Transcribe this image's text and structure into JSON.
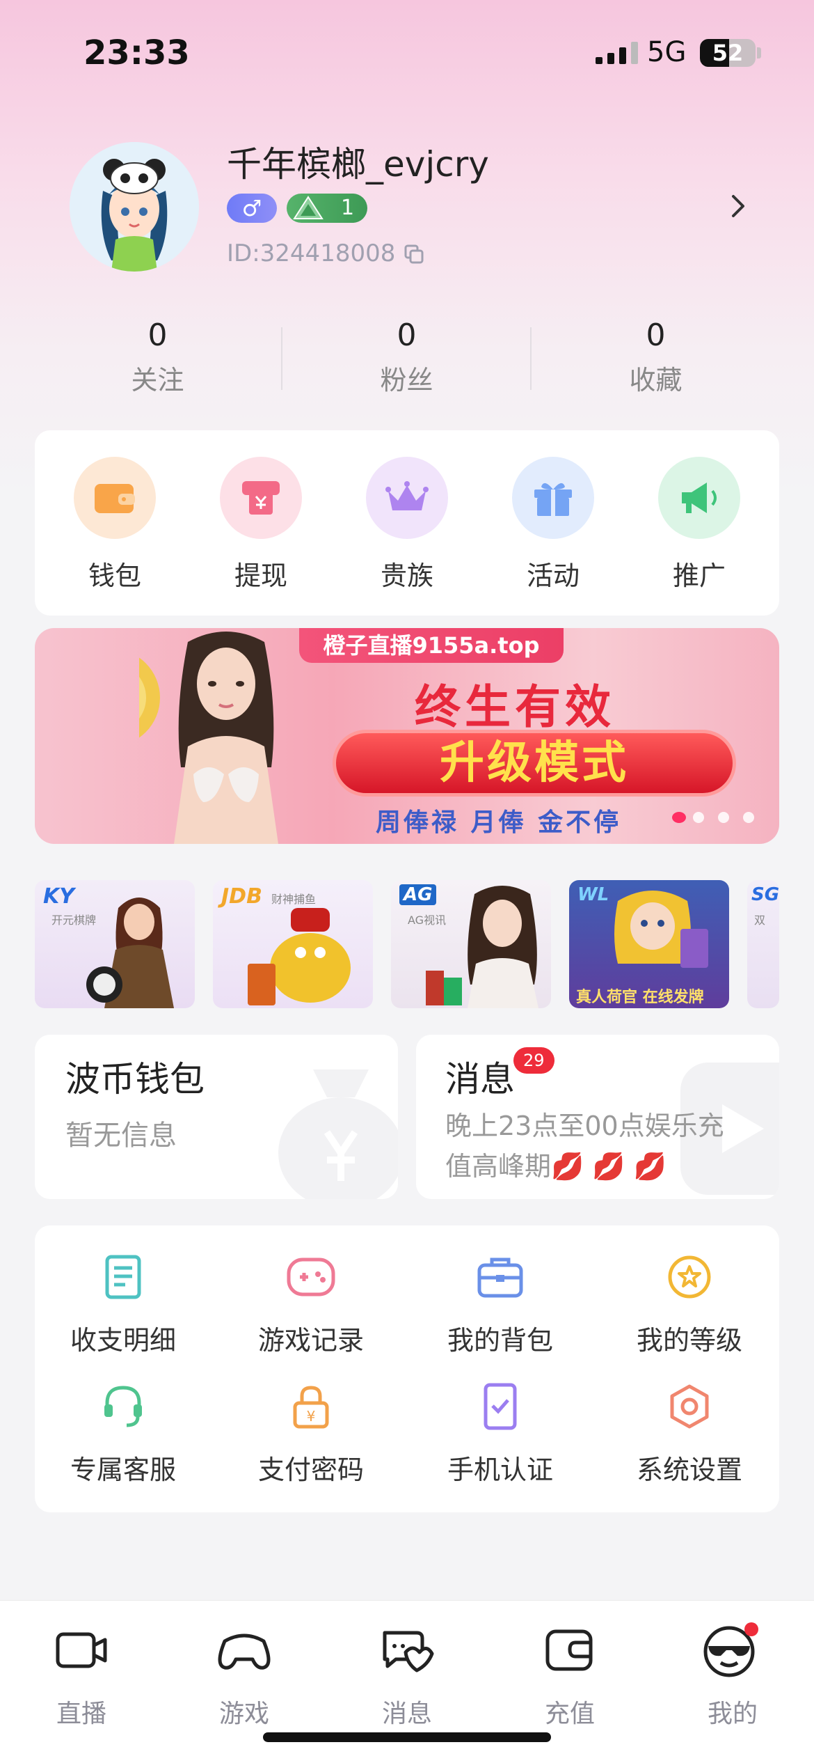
{
  "status": {
    "time": "23:33",
    "network": "5G",
    "battery": "52"
  },
  "profile": {
    "username": "千年槟榔_evjcry",
    "gender_symbol": "♂",
    "level": "1",
    "id": "ID:324418008"
  },
  "stats": [
    {
      "value": "0",
      "label": "关注"
    },
    {
      "value": "0",
      "label": "粉丝"
    },
    {
      "value": "0",
      "label": "收藏"
    }
  ],
  "quick": [
    {
      "label": "钱包",
      "color": "#f8a048"
    },
    {
      "label": "提现",
      "color": "#f2607e"
    },
    {
      "label": "贵族",
      "color": "#a77cf0"
    },
    {
      "label": "活动",
      "color": "#6f9ef5"
    },
    {
      "label": "推广",
      "color": "#3ec47a"
    }
  ],
  "banner": {
    "top": "橙子直播9155a.top",
    "main": "终生有效",
    "pill": "升级模式",
    "sub": "周俸禄  月俸  金不停"
  },
  "games": [
    {
      "logo": "KY",
      "sub": "开元棋牌"
    },
    {
      "logo": "JDB",
      "sub": "财神捕鱼"
    },
    {
      "logo": "AG",
      "sub": "AG视讯"
    },
    {
      "logo": "WL",
      "sub": "真人荷官 在线发牌"
    },
    {
      "logo": "SG",
      "sub": "双"
    }
  ],
  "wallet": {
    "title": "波币钱包",
    "text": "暂无信息"
  },
  "message": {
    "title": "消息",
    "badge": "29",
    "text1": "晚上23点至00点娱乐充",
    "text2": "值高峰期💋 💋 💋"
  },
  "menu": [
    {
      "label": "收支明细"
    },
    {
      "label": "游戏记录"
    },
    {
      "label": "我的背包"
    },
    {
      "label": "我的等级"
    },
    {
      "label": "专属客服"
    },
    {
      "label": "支付密码"
    },
    {
      "label": "手机认证"
    },
    {
      "label": "系统设置"
    }
  ],
  "tabs": [
    {
      "label": "直播"
    },
    {
      "label": "游戏"
    },
    {
      "label": "消息"
    },
    {
      "label": "充值"
    },
    {
      "label": "我的"
    }
  ]
}
